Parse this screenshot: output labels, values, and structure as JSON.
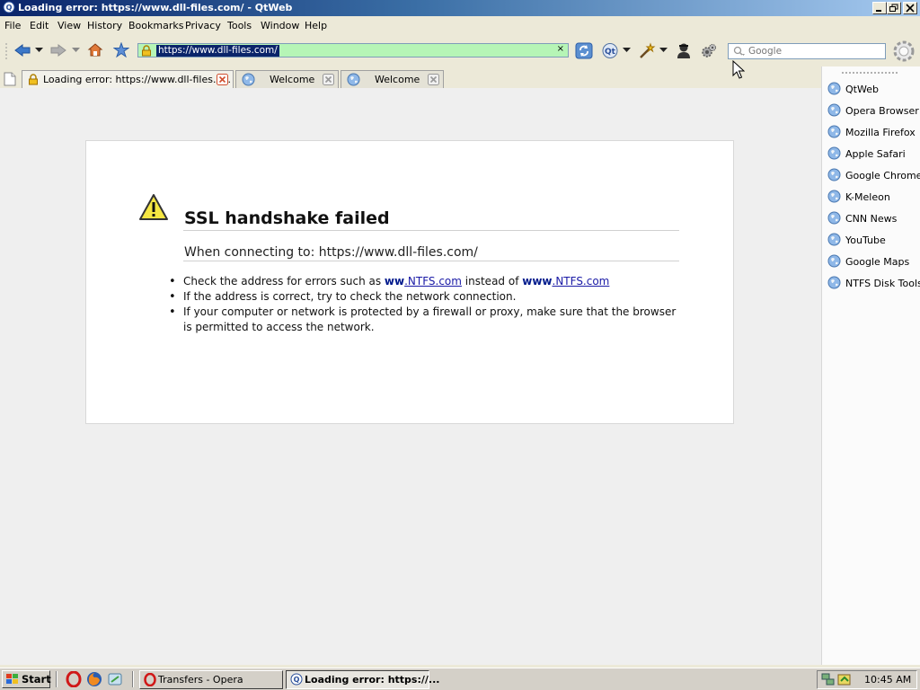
{
  "window": {
    "title": "Loading error: https://www.dll-files.com/ - QtWeb",
    "app_icon": "qtweb-icon"
  },
  "menu": {
    "items": [
      "File",
      "Edit",
      "View",
      "History",
      "Bookmarks",
      "Privacy",
      "Tools",
      "Window",
      "Help"
    ]
  },
  "toolbar": {
    "url": "https://www.dll-files.com/",
    "search_placeholder": "Google",
    "address_bg": "#b6f5b6"
  },
  "tabs": [
    {
      "label": "Loading error: https://www.dll-files.c...",
      "active": true
    },
    {
      "label": "Welcome",
      "active": false
    },
    {
      "label": "Welcome",
      "active": false
    }
  ],
  "error": {
    "title": "SSL handshake failed",
    "subtitle": "When connecting to: https://www.dll-files.com/",
    "item1_pre": "Check the address for errors such as ",
    "item1_link1_bold": "ww",
    "item1_link1": ".NTFS.com",
    "item1_mid": " instead of ",
    "item1_link2_bold": "www",
    "item1_link2": ".NTFS.com",
    "item2": "If the address is correct, try to check the network connection.",
    "item3": "If your computer or network is protected by a firewall or proxy, make sure that the browser is permitted to access the network."
  },
  "bookmarks": [
    "QtWeb",
    "Opera Browser",
    "Mozilla Firefox",
    "Apple Safari",
    "Google Chrome",
    "K-Meleon",
    "CNN News",
    "YouTube",
    "Google Maps",
    "NTFS Disk Tools"
  ],
  "taskbar": {
    "start_label": "Start",
    "tasks": [
      "Transfers - Opera",
      "Loading error: https://..."
    ],
    "clock": "10:45 AM"
  }
}
